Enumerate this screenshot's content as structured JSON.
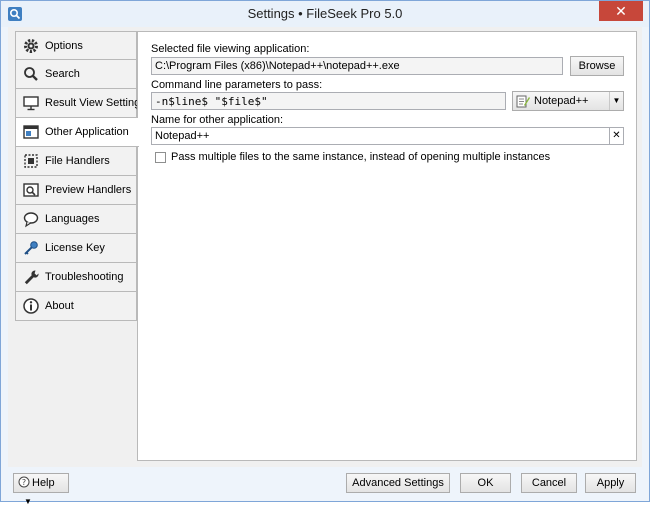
{
  "window": {
    "title": "Settings • FileSeek Pro 5.0",
    "close_glyph": "✕"
  },
  "sidebar": {
    "items": [
      {
        "label": "Options",
        "icon": "gear-icon"
      },
      {
        "label": "Search",
        "icon": "search-icon"
      },
      {
        "label": "Result View Settings",
        "icon": "monitor-icon"
      },
      {
        "label": "Other Application",
        "icon": "window-icon"
      },
      {
        "label": "File Handlers",
        "icon": "file-handler-icon"
      },
      {
        "label": "Preview Handlers",
        "icon": "preview-icon"
      },
      {
        "label": "Languages",
        "icon": "speech-bubble-icon"
      },
      {
        "label": "License Key",
        "icon": "key-icon"
      },
      {
        "label": "Troubleshooting",
        "icon": "wrench-icon"
      },
      {
        "label": "About",
        "icon": "info-icon"
      }
    ],
    "active_index": 3
  },
  "panel": {
    "app_label": "Selected file viewing application:",
    "app_path": "C:\\Program Files (x86)\\Notepad++\\notepad++.exe",
    "browse_label": "Browse",
    "params_label": "Command line parameters to pass:",
    "params_value": "-n$line$ \"$file$\"",
    "preset_selected": "Notepad++",
    "name_label": "Name for other application:",
    "name_value": "Notepad++",
    "clear_glyph": "✕",
    "checkbox_label": "Pass multiple files to the same instance, instead of opening multiple instances",
    "checkbox_checked": false
  },
  "footer": {
    "help_label": "Help",
    "advanced_label": "Advanced Settings",
    "ok_label": "OK",
    "cancel_label": "Cancel",
    "apply_label": "Apply"
  }
}
